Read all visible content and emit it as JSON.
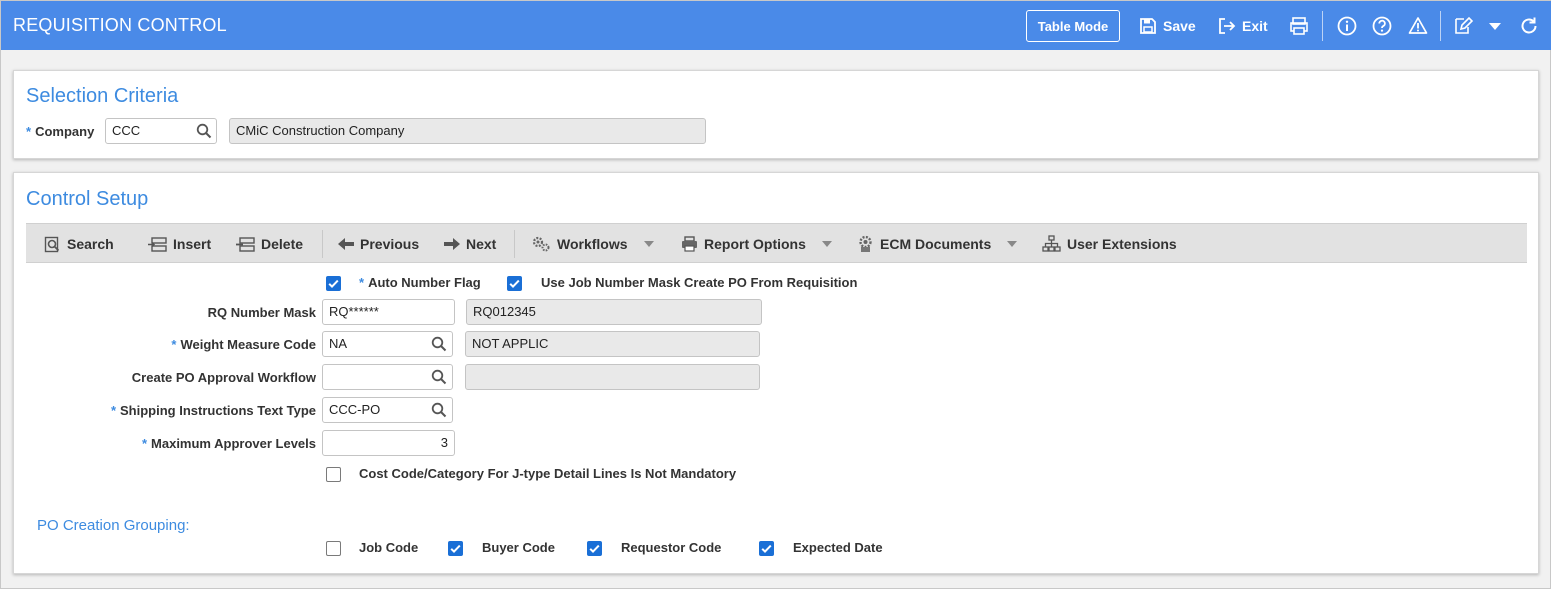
{
  "header": {
    "title": "REQUISITION CONTROL",
    "table_mode": "Table Mode",
    "save": "Save",
    "exit": "Exit"
  },
  "selection": {
    "title": "Selection Criteria",
    "company_label": "Company",
    "company_value": "CCC",
    "company_name": "CMiC Construction Company"
  },
  "control": {
    "title": "Control Setup",
    "toolbar": {
      "search": "Search",
      "insert": "Insert",
      "delete": "Delete",
      "previous": "Previous",
      "next": "Next",
      "workflows": "Workflows",
      "report_options": "Report Options",
      "ecm_documents": "ECM Documents",
      "user_extensions": "User Extensions"
    },
    "auto_number_flag_label": "Auto Number Flag",
    "auto_number_flag": true,
    "use_job_mask_label": "Use Job Number Mask Create PO From Requisition",
    "use_job_mask": true,
    "rq_mask_label": "RQ Number Mask",
    "rq_mask_value": "RQ******",
    "rq_mask_example": "RQ012345",
    "weight_label": "Weight Measure Code",
    "weight_value": "NA",
    "weight_desc": "NOT APPLIC",
    "workflow_label": "Create PO Approval Workflow",
    "workflow_value": "",
    "workflow_desc": "",
    "shipping_label": "Shipping Instructions Text Type",
    "shipping_value": "CCC-PO",
    "max_approver_label": "Maximum Approver Levels",
    "max_approver_value": "3",
    "cost_code_label": "Cost Code/Category For J-type Detail Lines Is Not Mandatory",
    "cost_code": false
  },
  "grouping": {
    "title": "PO Creation Grouping:",
    "job_code_label": "Job Code",
    "job_code": false,
    "buyer_code_label": "Buyer Code",
    "buyer_code": true,
    "requestor_code_label": "Requestor Code",
    "requestor_code": true,
    "expected_date_label": "Expected Date",
    "expected_date": true
  },
  "colors": {
    "header_bg": "#4a8ae8",
    "accent": "#3d8be0",
    "checkbox_on": "#1a6fd6"
  }
}
